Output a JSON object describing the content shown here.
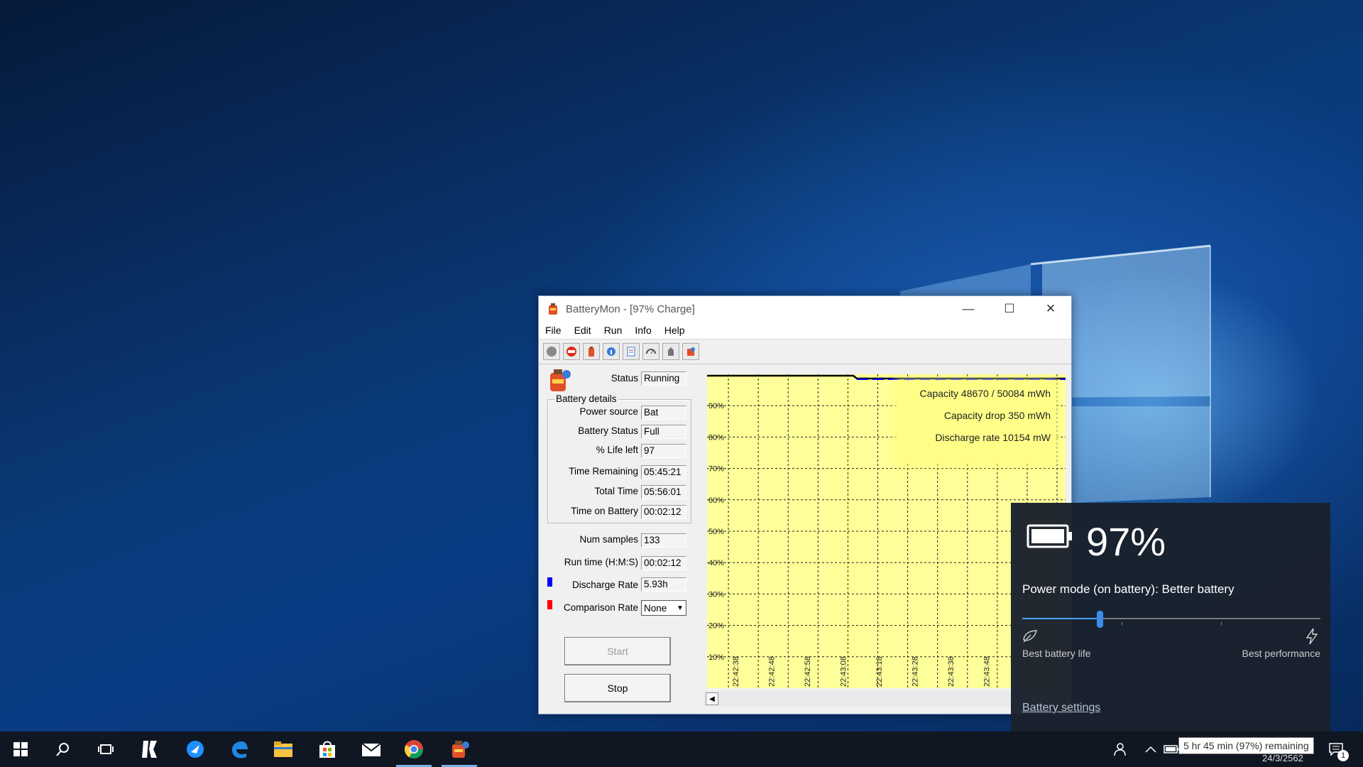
{
  "window": {
    "title": "BatteryMon - [97% Charge]",
    "menu": [
      "File",
      "Edit",
      "Run",
      "Info",
      "Help"
    ]
  },
  "panel": {
    "status_label": "Status",
    "status_value": "Running",
    "details_legend": "Battery details",
    "rows": [
      {
        "label": "Power source",
        "value": "Bat"
      },
      {
        "label": "Battery Status",
        "value": "Full"
      },
      {
        "label": "% Life left",
        "value": "97"
      },
      {
        "label": "Time Remaining",
        "value": "05:45:21"
      },
      {
        "label": "Total Time",
        "value": "05:56:01"
      },
      {
        "label": "Time on Battery",
        "value": "00:02:12"
      }
    ],
    "num_samples_label": "Num samples",
    "num_samples_value": "133",
    "run_time_label": "Run time (H:M:S)",
    "run_time_value": "00:02:12",
    "discharge_label": "Discharge Rate",
    "discharge_value": "5.93h",
    "discharge_color": "#0000ff",
    "comparison_label": "Comparison Rate",
    "comparison_value": "None",
    "comparison_color": "#ff0000",
    "start_label": "Start",
    "stop_label": "Stop"
  },
  "graph": {
    "background": "#ffff99",
    "y_ticks": [
      "90%",
      "80%",
      "70%",
      "60%",
      "50%",
      "40%",
      "30%",
      "20%",
      "10%"
    ],
    "x_ticks": [
      "22:42:38",
      "22:42:48",
      "22:42:58",
      "22:43:08",
      "22:43:18",
      "22:43:28",
      "22:43:38",
      "22:43:48"
    ],
    "info": [
      "Capacity 48670 / 50084 mWh",
      "Capacity drop 350 mWh",
      "Discharge rate 10154 mW"
    ]
  },
  "flyout": {
    "percent": "97%",
    "power_mode": "Power mode (on battery): Better battery",
    "slider_value": 0.26,
    "left_label": "Best battery life",
    "right_label": "Best performance",
    "settings_link": "Battery settings"
  },
  "taskbar": {
    "tooltip": "5 hr 45 min (97%) remaining",
    "date": "24/3/2562",
    "notification_count": "1"
  }
}
